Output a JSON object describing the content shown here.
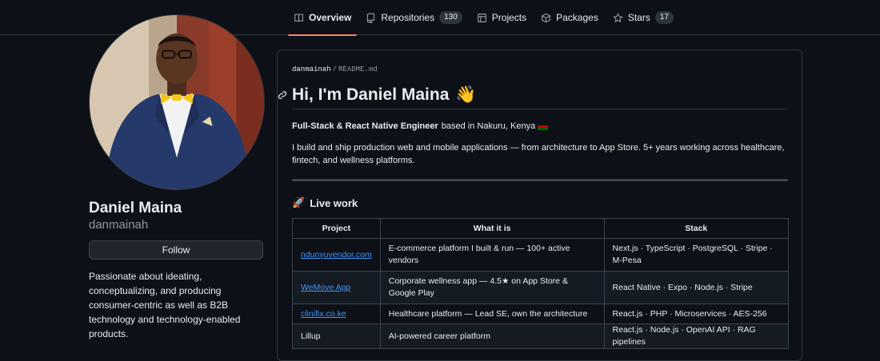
{
  "tabs": [
    {
      "label": "Overview",
      "icon": "book-icon",
      "active": true
    },
    {
      "label": "Repositories",
      "icon": "repo-icon",
      "count": "130"
    },
    {
      "label": "Projects",
      "icon": "table-icon"
    },
    {
      "label": "Packages",
      "icon": "package-icon"
    },
    {
      "label": "Stars",
      "icon": "star-icon",
      "count": "17"
    }
  ],
  "profile": {
    "name": "Daniel Maina",
    "login": "danmainah",
    "follow_label": "Follow",
    "bio": "Passionate about ideating, conceptualizing, and producing consumer-centric as well as B2B technology and technology-enabled products."
  },
  "readme": {
    "owner": "danmainah",
    "separator": "/",
    "file": "README.md",
    "title": "Hi, I'm Daniel Maina",
    "title_emoji": "👋",
    "role": "Full-Stack & React Native Engineer",
    "location": "based in Nakuru, Kenya",
    "intro": "I build and ship production web and mobile applications — from architecture to App Store. 5+ years working across healthcare, fintech, and wellness platforms.",
    "section_title": "Live work",
    "section_emoji": "🚀",
    "table": {
      "headers": [
        "Project",
        "What it is",
        "Stack"
      ],
      "rows": [
        {
          "project": "ndunyuvendor.com",
          "link": true,
          "what": "E-commerce platform I built & run — 100+ active vendors",
          "stack": "Next.js · TypeScript · PostgreSQL · Stripe · M-Pesa"
        },
        {
          "project": "WeMove App",
          "link": true,
          "what": "Corporate wellness app — 4.5★ on App Store & Google Play",
          "stack": "React Native · Expo · Node.js · Stripe"
        },
        {
          "project": "clinifix.co.ke",
          "link": true,
          "what": "Healthcare platform — Lead SE, own the architecture",
          "stack": "React.js · PHP · Microservices · AES-256"
        },
        {
          "project": "Lillup",
          "link": false,
          "what": "AI-powered career platform",
          "stack": "React.js · Node.js · OpenAI API · RAG pipelines"
        }
      ]
    }
  },
  "colors": {
    "background": "#0d1117",
    "border": "#30363d",
    "accent_underline": "#f78166",
    "link": "#4493f8",
    "muted": "#9198a1"
  }
}
